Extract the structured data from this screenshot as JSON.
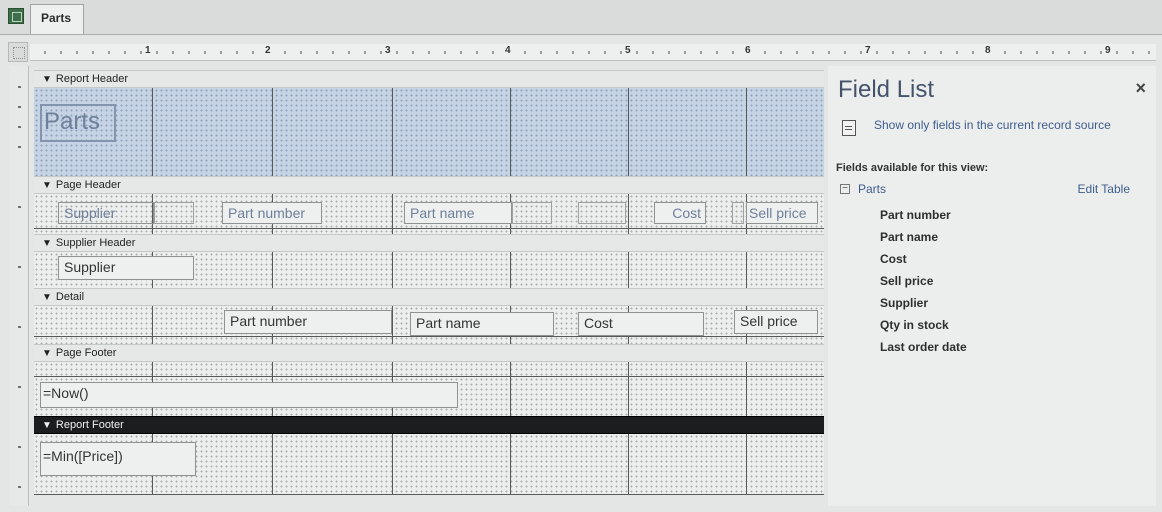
{
  "window": {
    "tab_label": "Parts",
    "icon": "access-table-icon"
  },
  "ruler": {
    "numbers": [
      "1",
      "2",
      "3",
      "4",
      "5",
      "6",
      "7",
      "8",
      "9"
    ]
  },
  "report": {
    "sections": {
      "report_header": "Report Header",
      "page_header": "Page Header",
      "supplier_header": "Supplier Header",
      "detail": "Detail",
      "page_footer": "Page Footer",
      "report_footer": "Report Footer"
    },
    "report_header_title": "Parts",
    "page_header_labels": {
      "supplier": "Supplier",
      "part_number": "Part number",
      "part_name": "Part name",
      "cost": "Cost",
      "sell_price": "Sell price"
    },
    "supplier_header_field": "Supplier",
    "detail_fields": {
      "part_number": "Part number",
      "part_name": "Part name",
      "cost": "Cost",
      "sell_price": "Sell price"
    },
    "page_footer_expression": "=Now()",
    "report_footer_expression": "=Min([Price])"
  },
  "field_list": {
    "title": "Field List",
    "close_glyph": "×",
    "show_only_label": "Show only fields in the current record source",
    "available_label": "Fields available for this view:",
    "table_toggle": "−",
    "table_name": "Parts",
    "edit_table_label": "Edit Table",
    "fields": [
      "Part number",
      "Part name",
      "Cost",
      "Sell price",
      "Supplier",
      "Qty in stock",
      "Last order date"
    ]
  }
}
